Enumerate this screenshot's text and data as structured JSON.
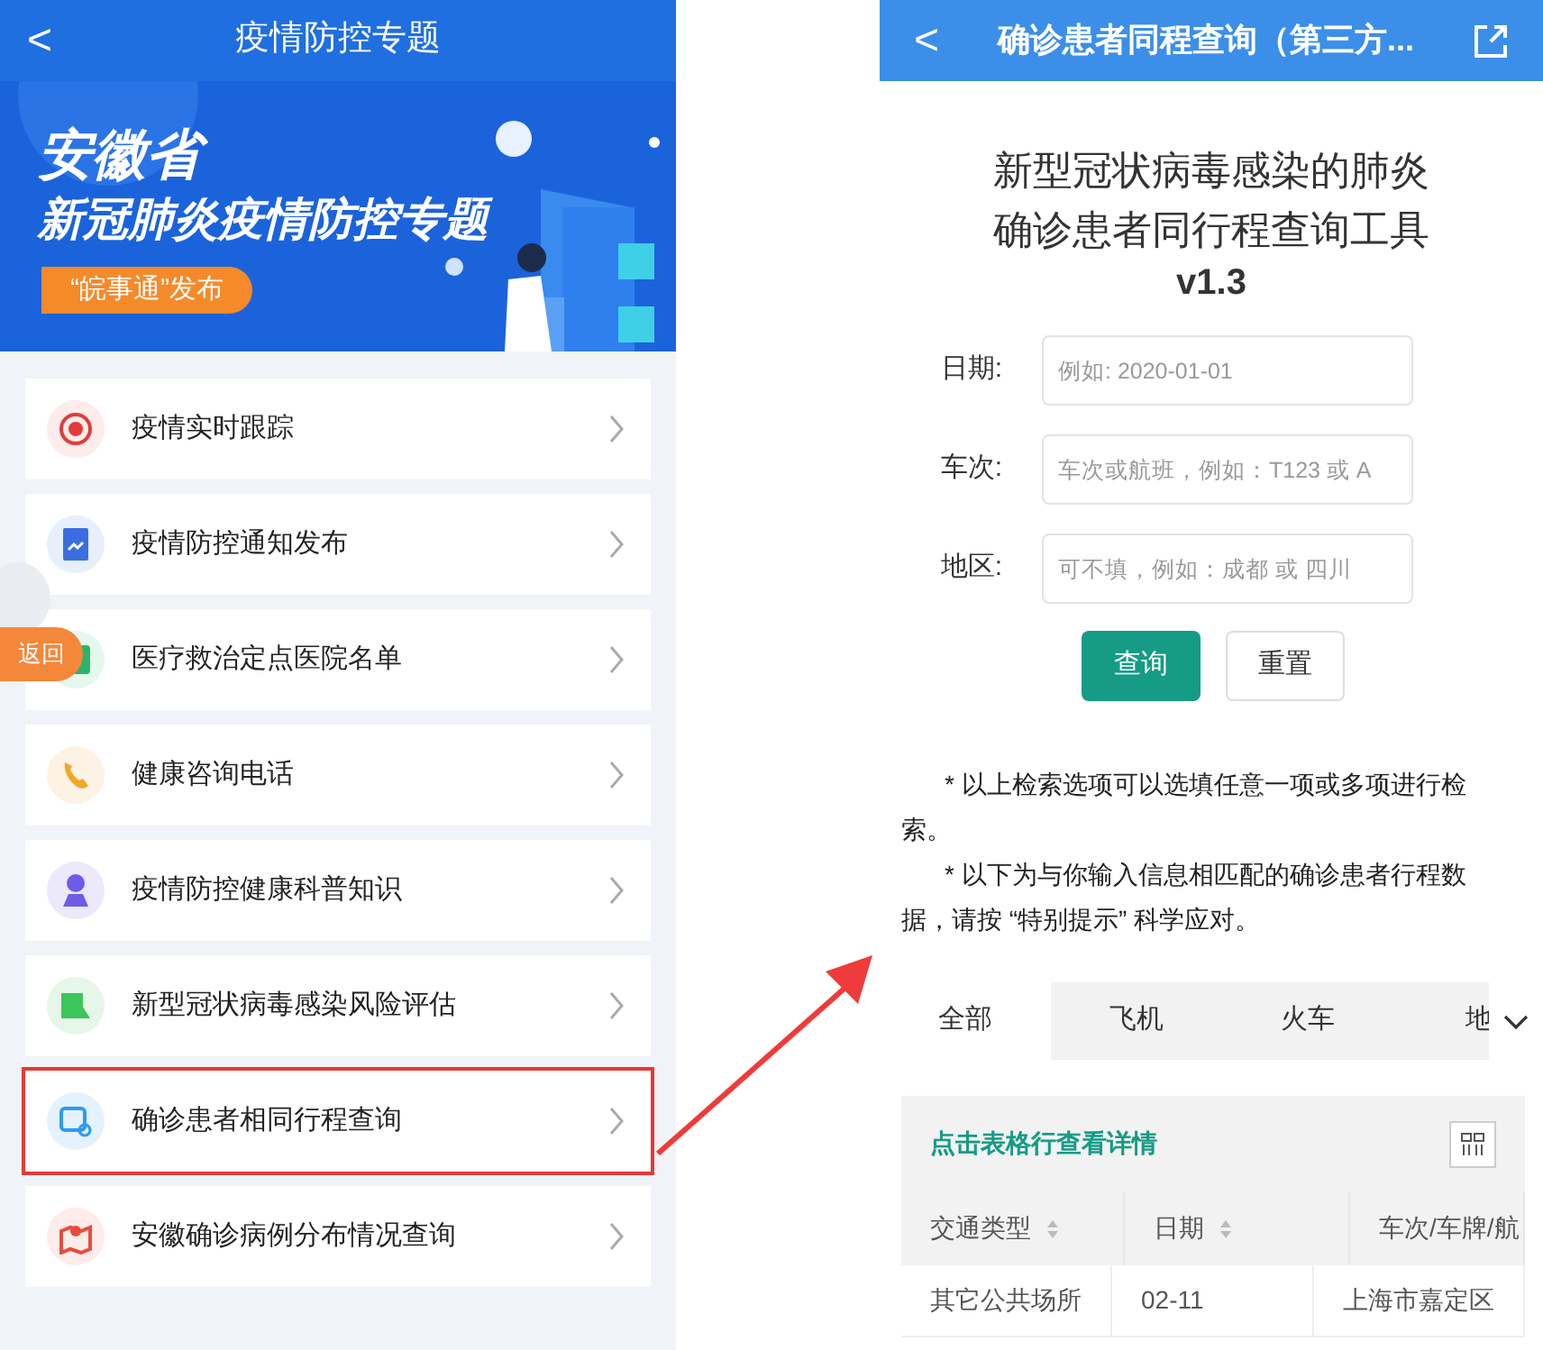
{
  "left_screen": {
    "header": {
      "back": "<",
      "title": "疫情防控专题"
    },
    "banner": {
      "province": "安徽省",
      "headline": "新冠肺炎疫情防控专题",
      "badge": "“皖事通”发布"
    },
    "menu_items": [
      {
        "label": "疫情实时跟踪",
        "highlighted": false
      },
      {
        "label": "疫情防控通知发布",
        "highlighted": false
      },
      {
        "label": "医疗救治定点医院名单",
        "highlighted": false
      },
      {
        "label": "健康咨询电话",
        "highlighted": false
      },
      {
        "label": "疫情防控健康科普知识",
        "highlighted": false
      },
      {
        "label": "新型冠状病毒感染风险评估",
        "highlighted": false
      },
      {
        "label": "确诊患者相同行程查询",
        "highlighted": true
      },
      {
        "label": "安徽确诊病例分布情况查询",
        "highlighted": false
      }
    ],
    "float_button": "返回"
  },
  "right_screen": {
    "header": {
      "back": "<",
      "title": "确诊患者同程查询（第三方..."
    },
    "tool_title": [
      "新型冠状病毒感染的肺炎",
      "确诊患者同行程查询工具"
    ],
    "version": "v1.3",
    "form": [
      {
        "label": "日期:",
        "placeholder": "例如: 2020-01-01"
      },
      {
        "label": "车次:",
        "placeholder": "车次或航班，例如：T123 或 A"
      },
      {
        "label": "地区:",
        "placeholder": "可不填，例如：成都 或 四川"
      }
    ],
    "buttons": [
      {
        "label": "查询",
        "kind": "primary"
      },
      {
        "label": "重置",
        "kind": "default"
      }
    ],
    "notes": [
      "* 以上检索选项可以选填任意一项或多项进行检索。",
      "* 以下为与你输入信息相匹配的确诊患者行程数据，请按 “特别提示” 科学应对。"
    ],
    "tabs": [
      {
        "label": "全部",
        "selected": true
      },
      {
        "label": "飞机",
        "selected": false
      },
      {
        "label": "火车",
        "selected": false
      },
      {
        "label": "地",
        "selected": false
      }
    ],
    "table": {
      "hint": "点击表格行查看详情",
      "columns": [
        {
          "label": "交通类型",
          "sortable": true
        },
        {
          "label": "日期",
          "sortable": true
        },
        {
          "label": "车次/车牌/航"
        }
      ],
      "rows": [
        [
          "其它公共场所",
          "02-11",
          "上海市嘉定区"
        ]
      ]
    }
  }
}
